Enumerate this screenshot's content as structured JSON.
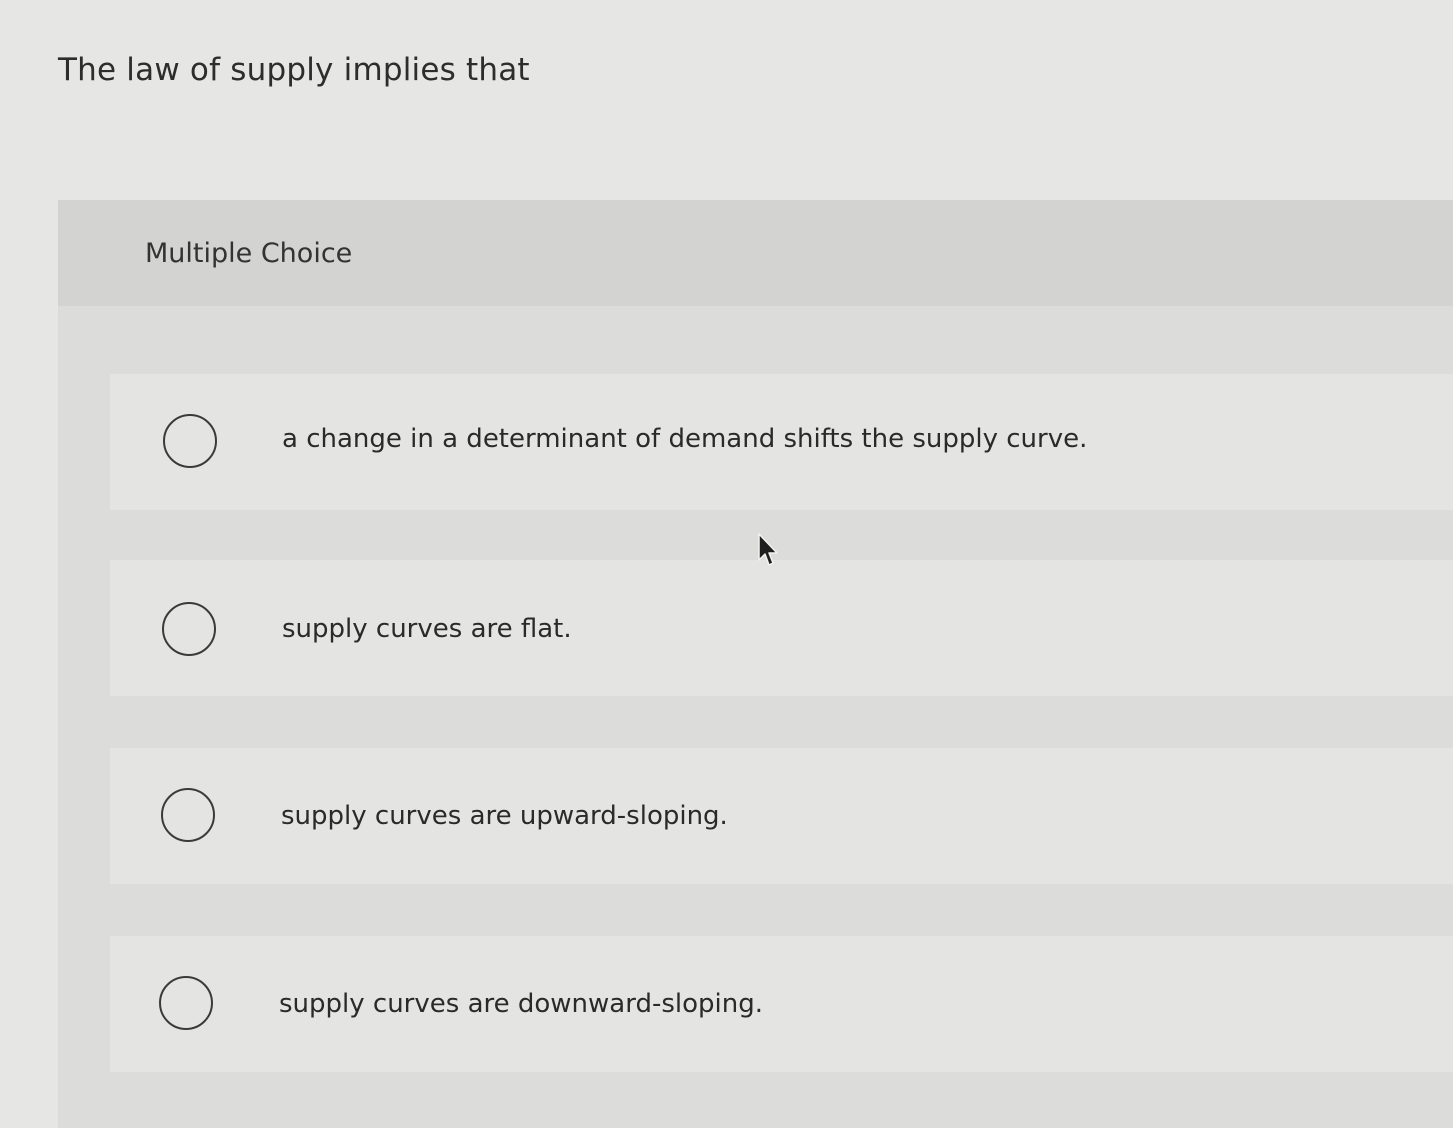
{
  "question": {
    "title": "The law of supply implies that"
  },
  "multiple_choice": {
    "label": "Multiple Choice",
    "options": [
      {
        "text": "a change in a determinant of demand shifts the supply curve."
      },
      {
        "text": "supply curves are flat."
      },
      {
        "text": "supply curves are upward-sloping."
      },
      {
        "text": "supply curves are downward-sloping."
      }
    ]
  },
  "colors": {
    "background": "#e6e6e4",
    "panel": "#dcdcda",
    "header": "#d3d3d1",
    "option_bg": "#e4e4e2",
    "text": "#2b2b2b"
  },
  "icons": {
    "cursor": "mouse-pointer-icon",
    "radio": "radio-circle-icon"
  }
}
